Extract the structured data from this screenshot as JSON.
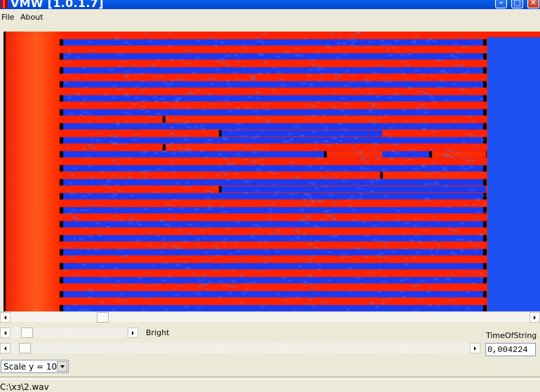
{
  "window": {
    "title": "VMW [1.0.1.7]"
  },
  "menu": {
    "items": [
      "File",
      "About"
    ]
  },
  "controls": {
    "bright_label": "Bright",
    "time_label": "TimeOfString",
    "time_value": "0,004224",
    "scale_value": "Scale y = 10",
    "bright_slider_fraction": 0.12,
    "offset_slider_fraction": 0.04,
    "view_scroll_fraction": 0.18
  },
  "status": {
    "path": "C:\\хз\\2.wav"
  },
  "colors": {
    "high": "#ff2200",
    "low": "#1030f0",
    "edge": "#000000"
  }
}
